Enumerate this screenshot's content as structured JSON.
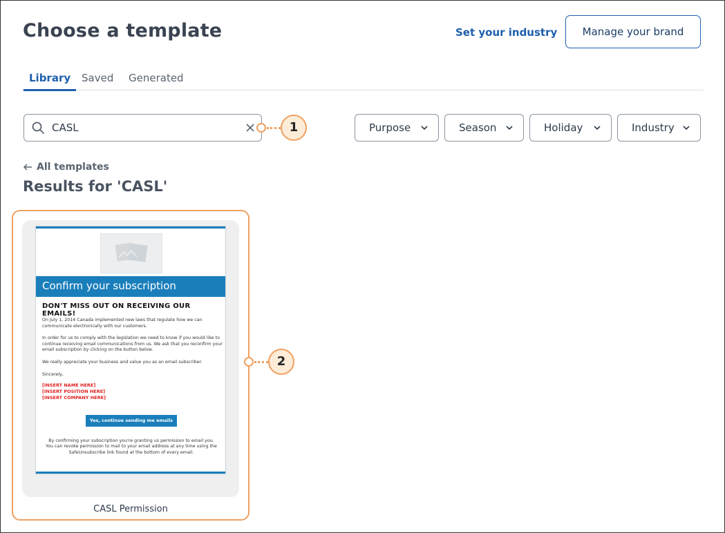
{
  "header": {
    "title": "Choose a template",
    "set_industry": "Set your industry",
    "manage_brand": "Manage your brand"
  },
  "tabs": [
    {
      "label": "Library",
      "active": true
    },
    {
      "label": "Saved",
      "active": false
    },
    {
      "label": "Generated",
      "active": false
    }
  ],
  "search": {
    "value": "CASL",
    "icon": "search-icon",
    "clear_icon": "close-icon"
  },
  "filters": [
    {
      "label": "Purpose"
    },
    {
      "label": "Season"
    },
    {
      "label": "Holiday"
    },
    {
      "label": "Industry"
    }
  ],
  "back_link": "All templates",
  "results_title": "Results for 'CASL'",
  "callouts": [
    "1",
    "2"
  ],
  "template_card": {
    "label": "CASL Permission",
    "preview": {
      "banner": "Confirm your subscription",
      "headline": "DON'T MISS OUT ON RECEIVING OUR EMAILS!",
      "para1": "On July 1, 2014 Canada implemented new laws that regulate how we can communicate electronically with our customers.",
      "para2": "In order for us to comply with the legislation we need to know if you would like to continue receiving email communications from us. We ask that you reconfirm your email subscription by clicking on the button below.",
      "para3": "We really appreciate your business and value you as an email subscriber.",
      "sign_off": "Sincerely,",
      "placeholder_name": "[INSERT NAME HERE]",
      "placeholder_position": "[INSERT POSITION HERE]",
      "placeholder_company": "[INSERT COMPANY HERE]",
      "cta": "Yes, continue sending me emails",
      "footer": "By confirming your subscription you're granting us permission to email you. You can revoke permission to mail to your email address at any time using the SafeUnsubscribe link found at the bottom of every email."
    }
  },
  "colors": {
    "accent": "#1d5fad",
    "callout": "#f0a060",
    "email_blue": "#1a7ebb"
  }
}
